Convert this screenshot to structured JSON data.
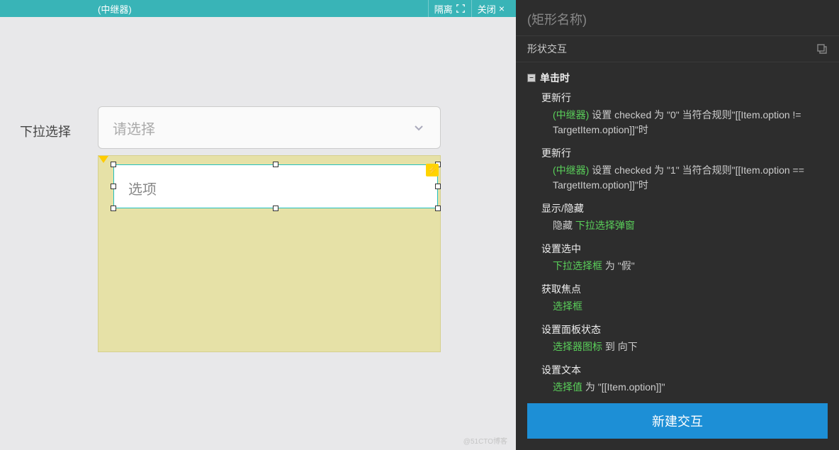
{
  "header": {
    "title": "(中继器)",
    "isolate": "隔离",
    "close": "关闭"
  },
  "canvas": {
    "label": "下拉选择",
    "placeholder": "请选择",
    "option_text": "选项"
  },
  "inspector": {
    "title": "(矩形名称)",
    "section": "形状交互",
    "event": "单击时",
    "actions": [
      {
        "label": "更新行",
        "detail_pre": "(中继器)",
        "detail_post": " 设置 checked 为 \"0\" 当符合规则\"[[Item.option != TargetItem.option]]\"时"
      },
      {
        "label": "更新行",
        "detail_pre": "(中继器)",
        "detail_post": " 设置 checked 为 \"1\" 当符合规则\"[[Item.option == TargetItem.option]]\"时"
      },
      {
        "label": "显示/隐藏",
        "detail_plain_pre": "隐藏 ",
        "detail_green": "下拉选择弹窗",
        "detail_plain_post": ""
      },
      {
        "label": "设置选中",
        "detail_green": "下拉选择框",
        "detail_plain_post": " 为 \"假\""
      },
      {
        "label": "获取焦点",
        "detail_green": "选择框",
        "detail_plain_post": ""
      },
      {
        "label": "设置面板状态",
        "detail_green": "选择器图标",
        "detail_plain_post": " 到 向下"
      },
      {
        "label": "设置文本",
        "detail_green": "选择值",
        "detail_plain_post": " 为 \"[[Item.option]]\""
      }
    ],
    "add": "+",
    "create_button": "新建交互"
  },
  "watermark": "@51CTO博客"
}
